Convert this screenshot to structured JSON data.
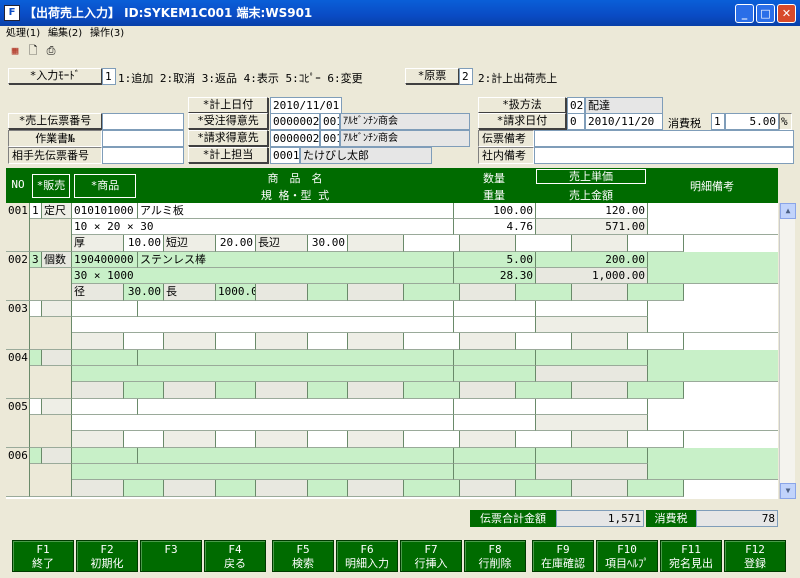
{
  "window": {
    "title": "【出荷売上入力】 ID:SYKEM1C001 端末:WS901",
    "icon": "app-icon"
  },
  "menu": [
    "処理(1)",
    "編集(2)",
    "操作(3)"
  ],
  "tools": [
    "calendar-icon",
    "new-document-icon",
    "print-icon"
  ],
  "input_mode": {
    "label": "*入力ﾓｰﾄﾞ",
    "value": "1",
    "options": "1:追加 2:取消 3:返品 4:表示 5:ｺﾋﾟｰ 6:変更"
  },
  "genpyo": {
    "label": "*原票",
    "value": "2",
    "options": "2:計上出荷売上"
  },
  "form": {
    "keijo_date_label": "*計上日付",
    "keijo_date": "2010/11/01",
    "juchu_label": "*受注得意先",
    "juchu_code": "0000002",
    "juchu_sub": "001",
    "juchu_name": "ｱﾙｾﾞﾝﾁﾝ商会",
    "seikyu_label": "*請求得意先",
    "seikyu_code": "0000002",
    "seikyu_sub": "001",
    "seikyu_name": "ｱﾙｾﾞﾝﾁﾝ商会",
    "tanto_label": "*計上担当",
    "tanto_code": "0001",
    "tanto_name": "たけびし太郎",
    "uriage_no_label": "*売上伝票番号",
    "uriage_no": "",
    "sagyo_label": "作業書№",
    "sagyo": "",
    "aite_label": "相手先伝票番号",
    "aite": "",
    "atsukai_label": "*扱方法",
    "atsukai_code": "02",
    "atsukai_name": "配達",
    "seikyu_date_label": "*請求日付",
    "seikyu_date_code": "0",
    "seikyu_date": "2010/11/20",
    "tax_label": "消費税",
    "tax_code": "1",
    "tax_rate": "5.00",
    "tax_unit": "%",
    "denpyo_biko_label": "伝票備考",
    "denpyo_biko": "",
    "shanai_biko_label": "社内備考",
    "shanai_biko": ""
  },
  "grid_headers": {
    "no": "NO",
    "hanbai": "*販売",
    "shohin": "*商品",
    "name": "商　品　名",
    "spec": "規 格・型 式",
    "qty": "数量",
    "weight": "重量",
    "price": "売上単価",
    "amount": "売上金額",
    "note": "明細備考"
  },
  "rows": [
    {
      "no": "001",
      "type": "1",
      "type_name": "定尺",
      "code": "010101000",
      "name": "アルミ板",
      "spec": "10 × 20 × 30",
      "qty": "100.00",
      "weight": "4.76",
      "price": "120.00",
      "amount": "571.00",
      "dims": [
        {
          "label": "厚",
          "value": "10.00"
        },
        {
          "label": "短辺",
          "value": "20.00"
        },
        {
          "label": "長辺",
          "value": "30.00"
        }
      ]
    },
    {
      "no": "002",
      "type": "3",
      "type_name": "個数",
      "code": "190400000",
      "name": "ステンレス棒",
      "spec": "30 × 1000",
      "qty": "5.00",
      "weight": "28.30",
      "price": "200.00",
      "amount": "1,000.00",
      "dims": [
        {
          "label": "径",
          "value": "30.00"
        },
        {
          "label": "長",
          "value": "1000.00"
        }
      ]
    },
    {
      "no": "003"
    },
    {
      "no": "004"
    },
    {
      "no": "005"
    },
    {
      "no": "006"
    }
  ],
  "totals": {
    "label": "伝票合計金額",
    "value": "1,571",
    "tax_label": "消費税",
    "tax_value": "78"
  },
  "fkeys": [
    {
      "key": "F1",
      "label": "終了"
    },
    {
      "key": "F2",
      "label": "初期化"
    },
    {
      "key": "F3",
      "label": ""
    },
    {
      "key": "F4",
      "label": "戻る"
    },
    {
      "key": "F5",
      "label": "検索"
    },
    {
      "key": "F6",
      "label": "明細入力"
    },
    {
      "key": "F7",
      "label": "行挿入"
    },
    {
      "key": "F8",
      "label": "行削除"
    },
    {
      "key": "F9",
      "label": "在庫確認"
    },
    {
      "key": "F10",
      "label": "項目ﾍﾙﾌﾟ"
    },
    {
      "key": "F11",
      "label": "宛名見出"
    },
    {
      "key": "F12",
      "label": "登録"
    }
  ]
}
